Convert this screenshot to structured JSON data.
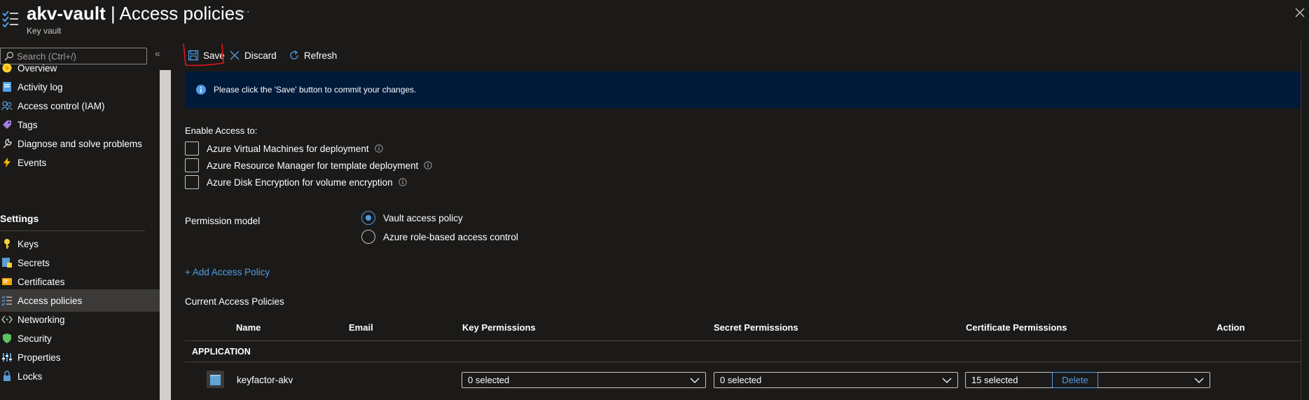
{
  "header": {
    "title_bold": "akv-vault",
    "title_rest": " | Access policies",
    "subtitle": "Key vault",
    "more": "···"
  },
  "sidebar": {
    "search_placeholder": "Search (Ctrl+/)",
    "collapse": "«",
    "items": [
      {
        "label": "Overview",
        "icon": "overview-icon"
      },
      {
        "label": "Activity log",
        "icon": "activity-log-icon"
      },
      {
        "label": "Access control (IAM)",
        "icon": "iam-icon"
      },
      {
        "label": "Tags",
        "icon": "tag-icon"
      },
      {
        "label": "Diagnose and solve problems",
        "icon": "wrench-icon"
      },
      {
        "label": "Events",
        "icon": "lightning-icon"
      }
    ],
    "settings_header": "Settings",
    "settings_items": [
      {
        "label": "Keys",
        "icon": "key-icon"
      },
      {
        "label": "Secrets",
        "icon": "secret-icon"
      },
      {
        "label": "Certificates",
        "icon": "certificate-icon"
      },
      {
        "label": "Access policies",
        "icon": "access-policies-icon",
        "active": true
      },
      {
        "label": "Networking",
        "icon": "networking-icon"
      },
      {
        "label": "Security",
        "icon": "shield-icon"
      },
      {
        "label": "Properties",
        "icon": "properties-icon"
      },
      {
        "label": "Locks",
        "icon": "lock-icon"
      }
    ]
  },
  "toolbar": {
    "save_label": "Save",
    "discard_label": "Discard",
    "refresh_label": "Refresh"
  },
  "info_banner": {
    "text": "Please click the 'Save' button to commit your changes."
  },
  "enable_access": {
    "label": "Enable Access to:",
    "options": [
      {
        "label": "Azure Virtual Machines for deployment",
        "checked": false
      },
      {
        "label": "Azure Resource Manager for template deployment",
        "checked": false
      },
      {
        "label": "Azure Disk Encryption for volume encryption",
        "checked": false
      }
    ]
  },
  "permission_model": {
    "label": "Permission model",
    "options": [
      {
        "label": "Vault access policy",
        "checked": true
      },
      {
        "label": "Azure role-based access control",
        "checked": false
      }
    ]
  },
  "add_policy_label": "+ Add Access Policy",
  "current_policies_label": "Current Access Policies",
  "table": {
    "headers": [
      "Name",
      "Email",
      "Key Permissions",
      "Secret Permissions",
      "Certificate Permissions",
      "Action"
    ],
    "group": "APPLICATION",
    "rows": [
      {
        "name": "keyfactor-akv",
        "key_permissions": "0 selected",
        "secret_permissions": "0 selected",
        "certificate_permissions": "15 selected",
        "action": "Delete"
      }
    ]
  },
  "colors": {
    "background": "#1b1a19",
    "accent": "#4f9ce8",
    "banner": "#001a3a",
    "annotation": "#e0161b"
  }
}
